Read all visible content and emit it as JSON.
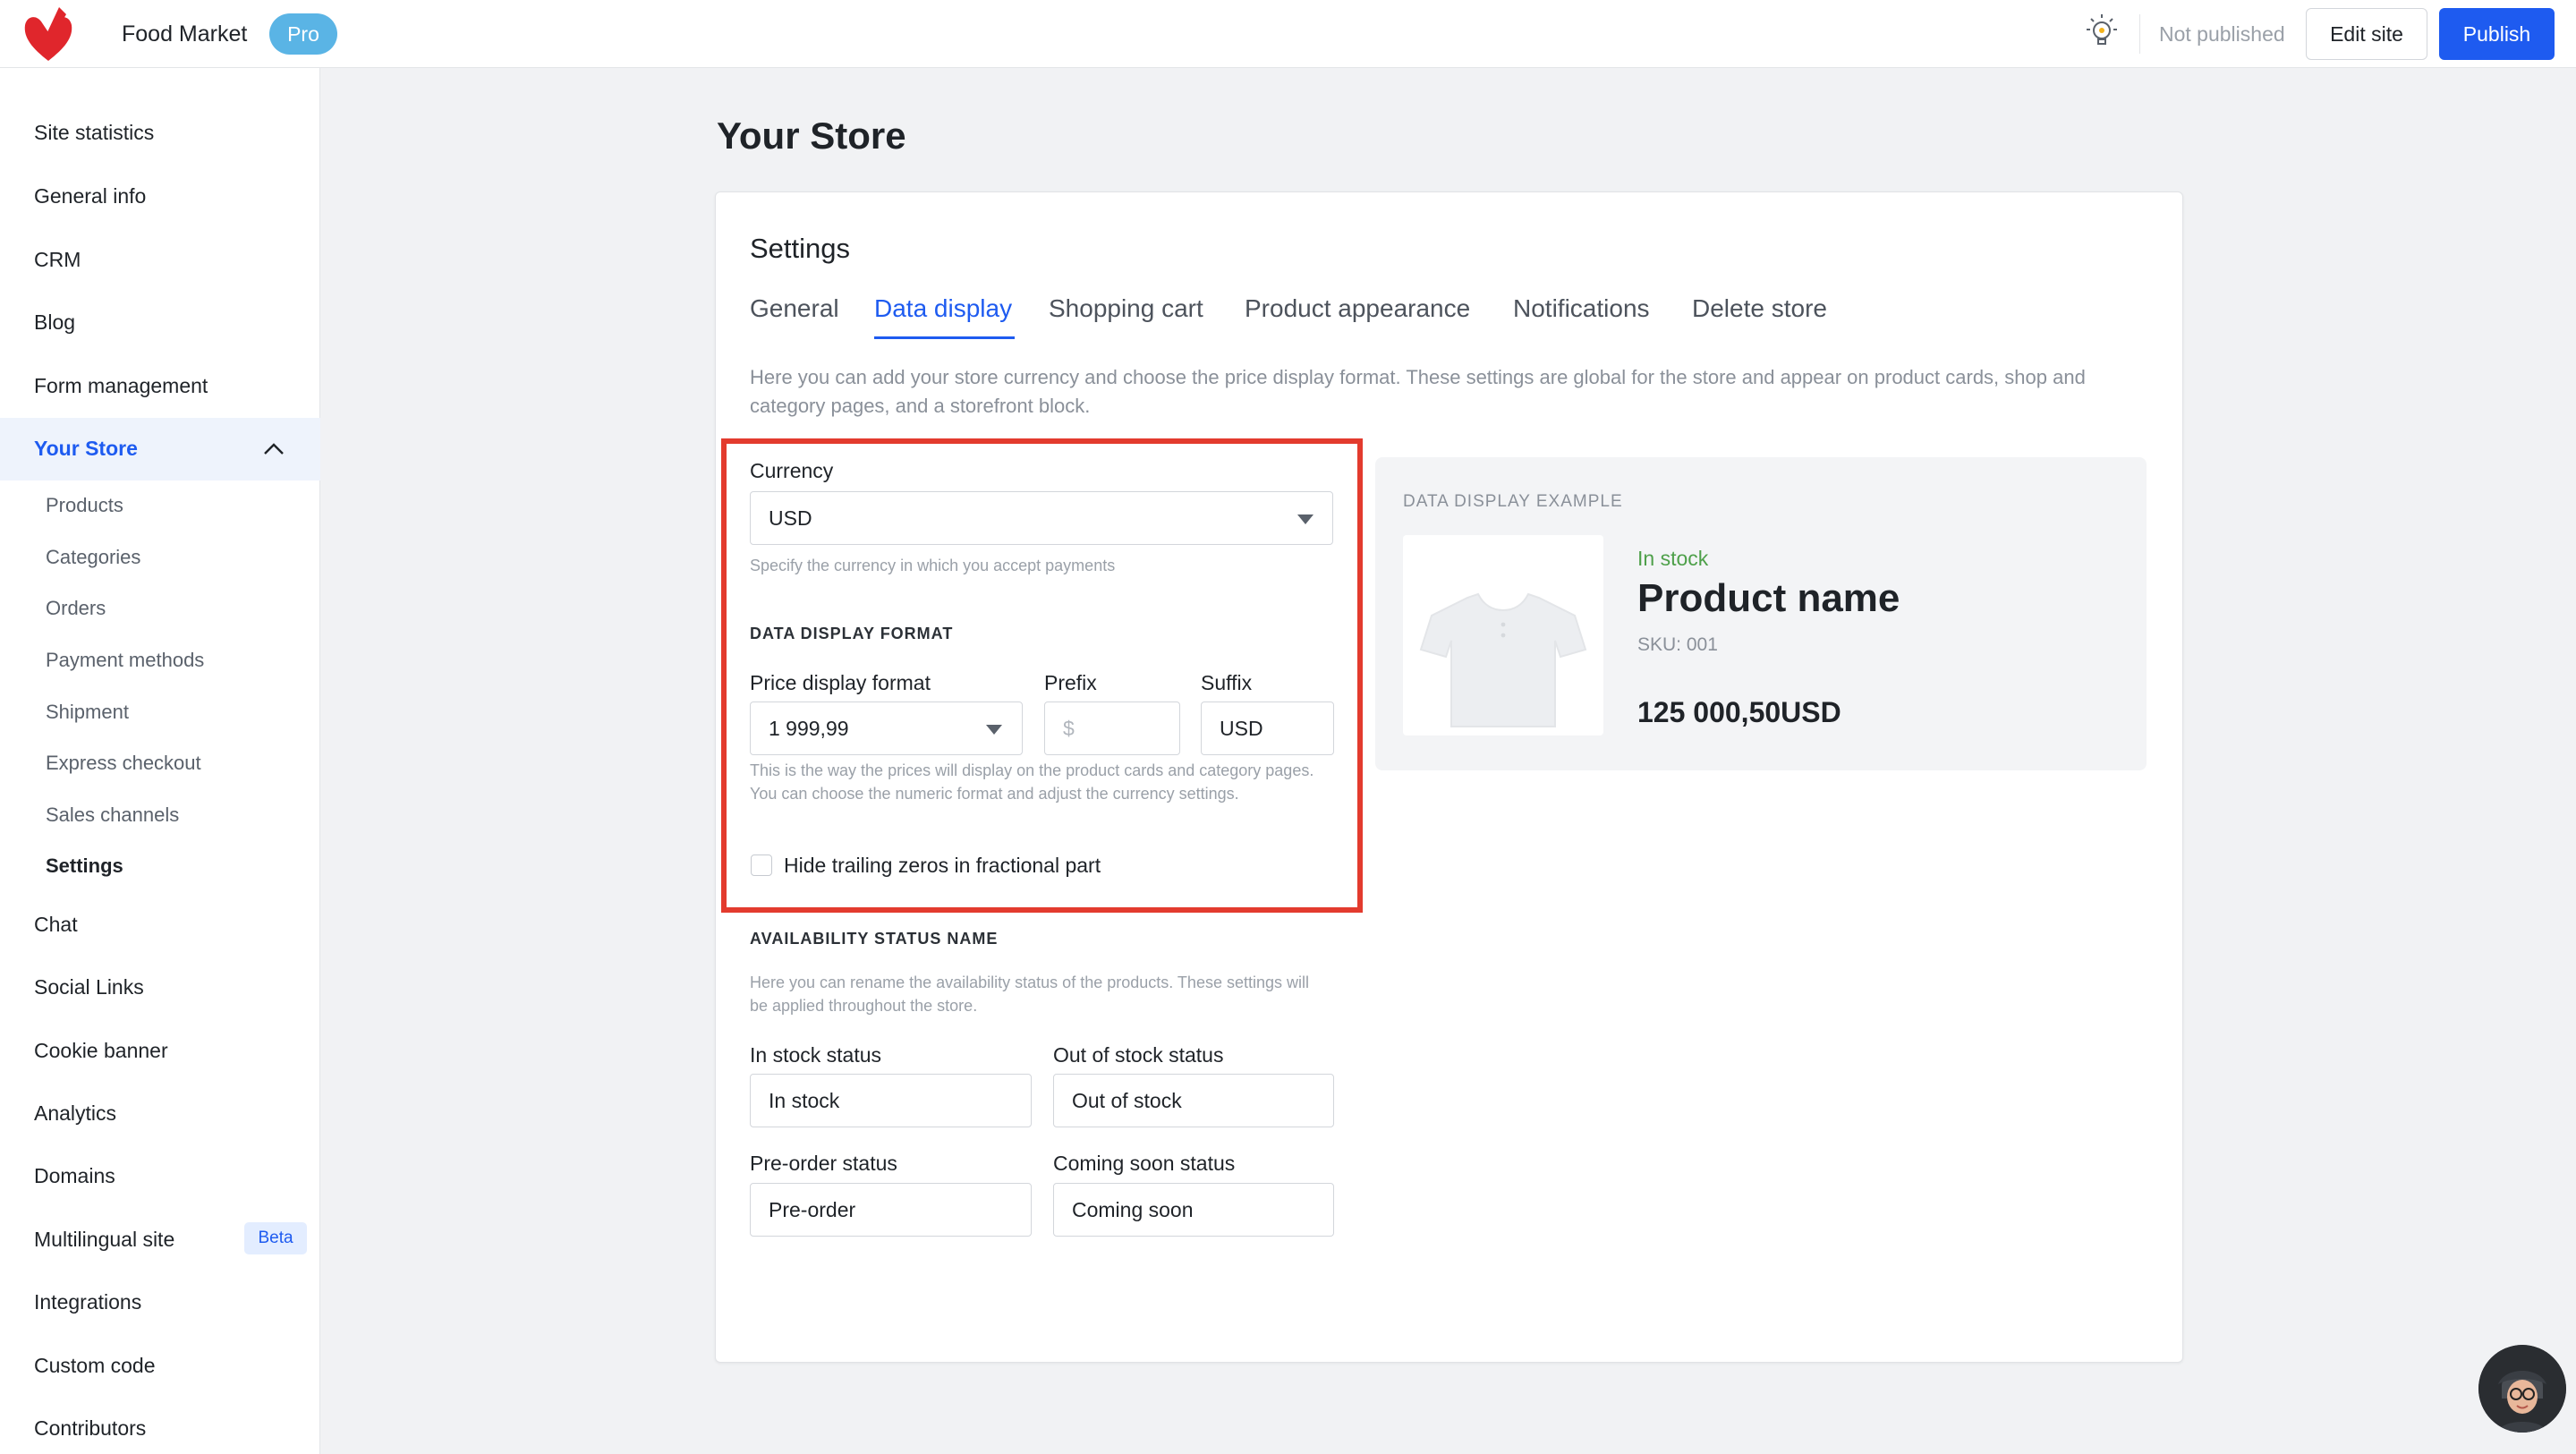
{
  "header": {
    "app_title": "Food Market",
    "plan_badge": "Pro",
    "publish_status": "Not published",
    "edit_label": "Edit site",
    "publish_label": "Publish"
  },
  "sidebar": {
    "items": [
      {
        "label": "Site statistics"
      },
      {
        "label": "General info"
      },
      {
        "label": "CRM"
      },
      {
        "label": "Blog"
      },
      {
        "label": "Form management"
      },
      {
        "label": "Your Store"
      },
      {
        "label": "Chat"
      },
      {
        "label": "Social Links"
      },
      {
        "label": "Cookie banner"
      },
      {
        "label": "Analytics"
      },
      {
        "label": "Domains"
      },
      {
        "label": "Multilingual site"
      },
      {
        "label": "Integrations"
      },
      {
        "label": "Custom code"
      },
      {
        "label": "Contributors"
      }
    ],
    "store_subitems": [
      {
        "label": "Products"
      },
      {
        "label": "Categories"
      },
      {
        "label": "Orders"
      },
      {
        "label": "Payment methods"
      },
      {
        "label": "Shipment"
      },
      {
        "label": "Express checkout"
      },
      {
        "label": "Sales channels"
      },
      {
        "label": "Settings"
      }
    ],
    "beta_badge": "Beta"
  },
  "main": {
    "page_title": "Your Store",
    "card_title": "Settings",
    "tabs": [
      {
        "label": "General"
      },
      {
        "label": "Data display"
      },
      {
        "label": "Shopping cart"
      },
      {
        "label": "Product appearance"
      },
      {
        "label": "Notifications"
      },
      {
        "label": "Delete store"
      }
    ],
    "intro": "Here you can add your store currency and choose the price display format. These settings are global for the store and appear on product cards, shop and category pages, and a storefront block."
  },
  "currency": {
    "label": "Currency",
    "value": "USD",
    "hint": "Specify the currency in which you accept payments"
  },
  "format": {
    "section_title": "DATA DISPLAY FORMAT",
    "price_label": "Price display format",
    "price_value": "1 999,99",
    "prefix_label": "Prefix",
    "prefix_placeholder": "$",
    "suffix_label": "Suffix",
    "suffix_value": "USD",
    "hint": "This is the way the prices will display on the product cards and category pages. You can choose the numeric format and adjust the currency settings.",
    "hide_zeros_label": "Hide trailing zeros in fractional part"
  },
  "availability": {
    "section_title": "AVAILABILITY STATUS NAME",
    "hint": "Here you can rename the availability status of the products. These settings will be applied throughout the store.",
    "in_stock_label": "In stock status",
    "in_stock_value": "In stock",
    "out_of_stock_label": "Out of stock status",
    "out_of_stock_value": "Out of stock",
    "preorder_label": "Pre-order status",
    "preorder_value": "Pre-order",
    "coming_soon_label": "Coming soon status",
    "coming_soon_value": "Coming soon"
  },
  "preview": {
    "heading": "DATA DISPLAY EXAMPLE",
    "stock": "In stock",
    "name": "Product name",
    "sku": "SKU: 001",
    "price": "125 000,50USD"
  },
  "colors": {
    "accent": "#1e5bf0",
    "highlight": "#e33b2e",
    "pro_badge": "#5ab4e5",
    "in_stock": "#4ea04a"
  }
}
